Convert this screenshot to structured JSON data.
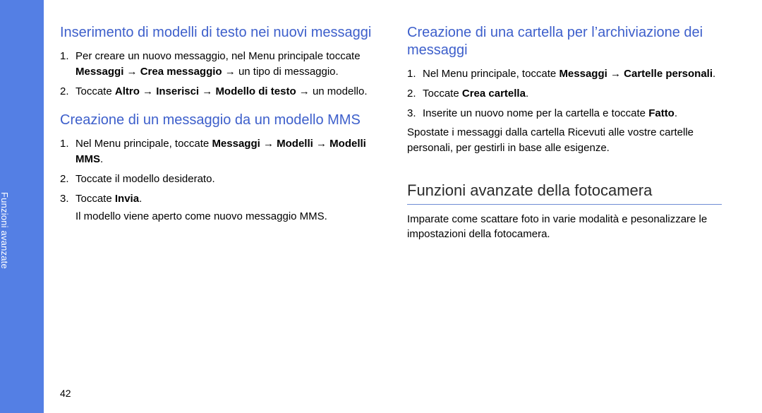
{
  "sidebar": {
    "label": "Funzioni avanzate"
  },
  "page_number": "42",
  "left_column": {
    "section1": {
      "heading": "Inserimento di modelli di testo nei nuovi messaggi",
      "steps": [
        {
          "pre": "Per creare un nuovo messaggio, nel Menu principale toccate ",
          "bold1": "Messaggi",
          "arrow1": " → ",
          "bold2": "Crea messaggio",
          "arrow2": " → ",
          "post": "un tipo di messaggio."
        },
        {
          "pre": "Toccate ",
          "bold1": "Altro",
          "arrow1": " → ",
          "bold2": "Inserisci",
          "arrow2": " → ",
          "bold3": "Modello di testo",
          "arrow3": " → ",
          "post": "un modello."
        }
      ]
    },
    "section2": {
      "heading": "Creazione di un messaggio da un modello MMS",
      "steps": [
        {
          "pre": "Nel Menu principale, toccate ",
          "bold1": "Messaggi",
          "arrow1": " → ",
          "bold2": "Modelli",
          "arrow2": " → ",
          "bold3": "Modelli MMS",
          "post": "."
        },
        {
          "pre": "Toccate il modello desiderato.",
          "bold1": "",
          "arrow1": "",
          "bold2": "",
          "arrow2": "",
          "post": ""
        },
        {
          "pre": "Toccate ",
          "bold1": "Invia",
          "arrow1": "",
          "bold2": "",
          "arrow2": "",
          "post": ".",
          "follow": "Il modello viene aperto come nuovo messaggio MMS."
        }
      ]
    }
  },
  "right_column": {
    "section1": {
      "heading": "Creazione di una cartella per l’archiviazione dei messaggi",
      "steps": [
        {
          "pre": "Nel Menu principale, toccate ",
          "bold1": "Messaggi",
          "arrow1": " → ",
          "bold2": "Cartelle personali",
          "arrow2": "",
          "post": "."
        },
        {
          "pre": "Toccate ",
          "bold1": "Crea cartella",
          "arrow1": "",
          "bold2": "",
          "arrow2": "",
          "post": "."
        },
        {
          "pre": "Inserite un nuovo nome per la cartella e toccate ",
          "bold1": "Fatto",
          "arrow1": "",
          "bold2": "",
          "arrow2": "",
          "post": "."
        }
      ],
      "para": "Spostate i messaggi dalla cartella Ricevuti alle vostre cartelle personali, per gestirli in base alle esigenze."
    },
    "section2": {
      "heading": "Funzioni avanzate della fotocamera",
      "para": "Imparate come scattare foto in varie modalità e pesonalizzare le impostazioni della fotocamera."
    }
  }
}
